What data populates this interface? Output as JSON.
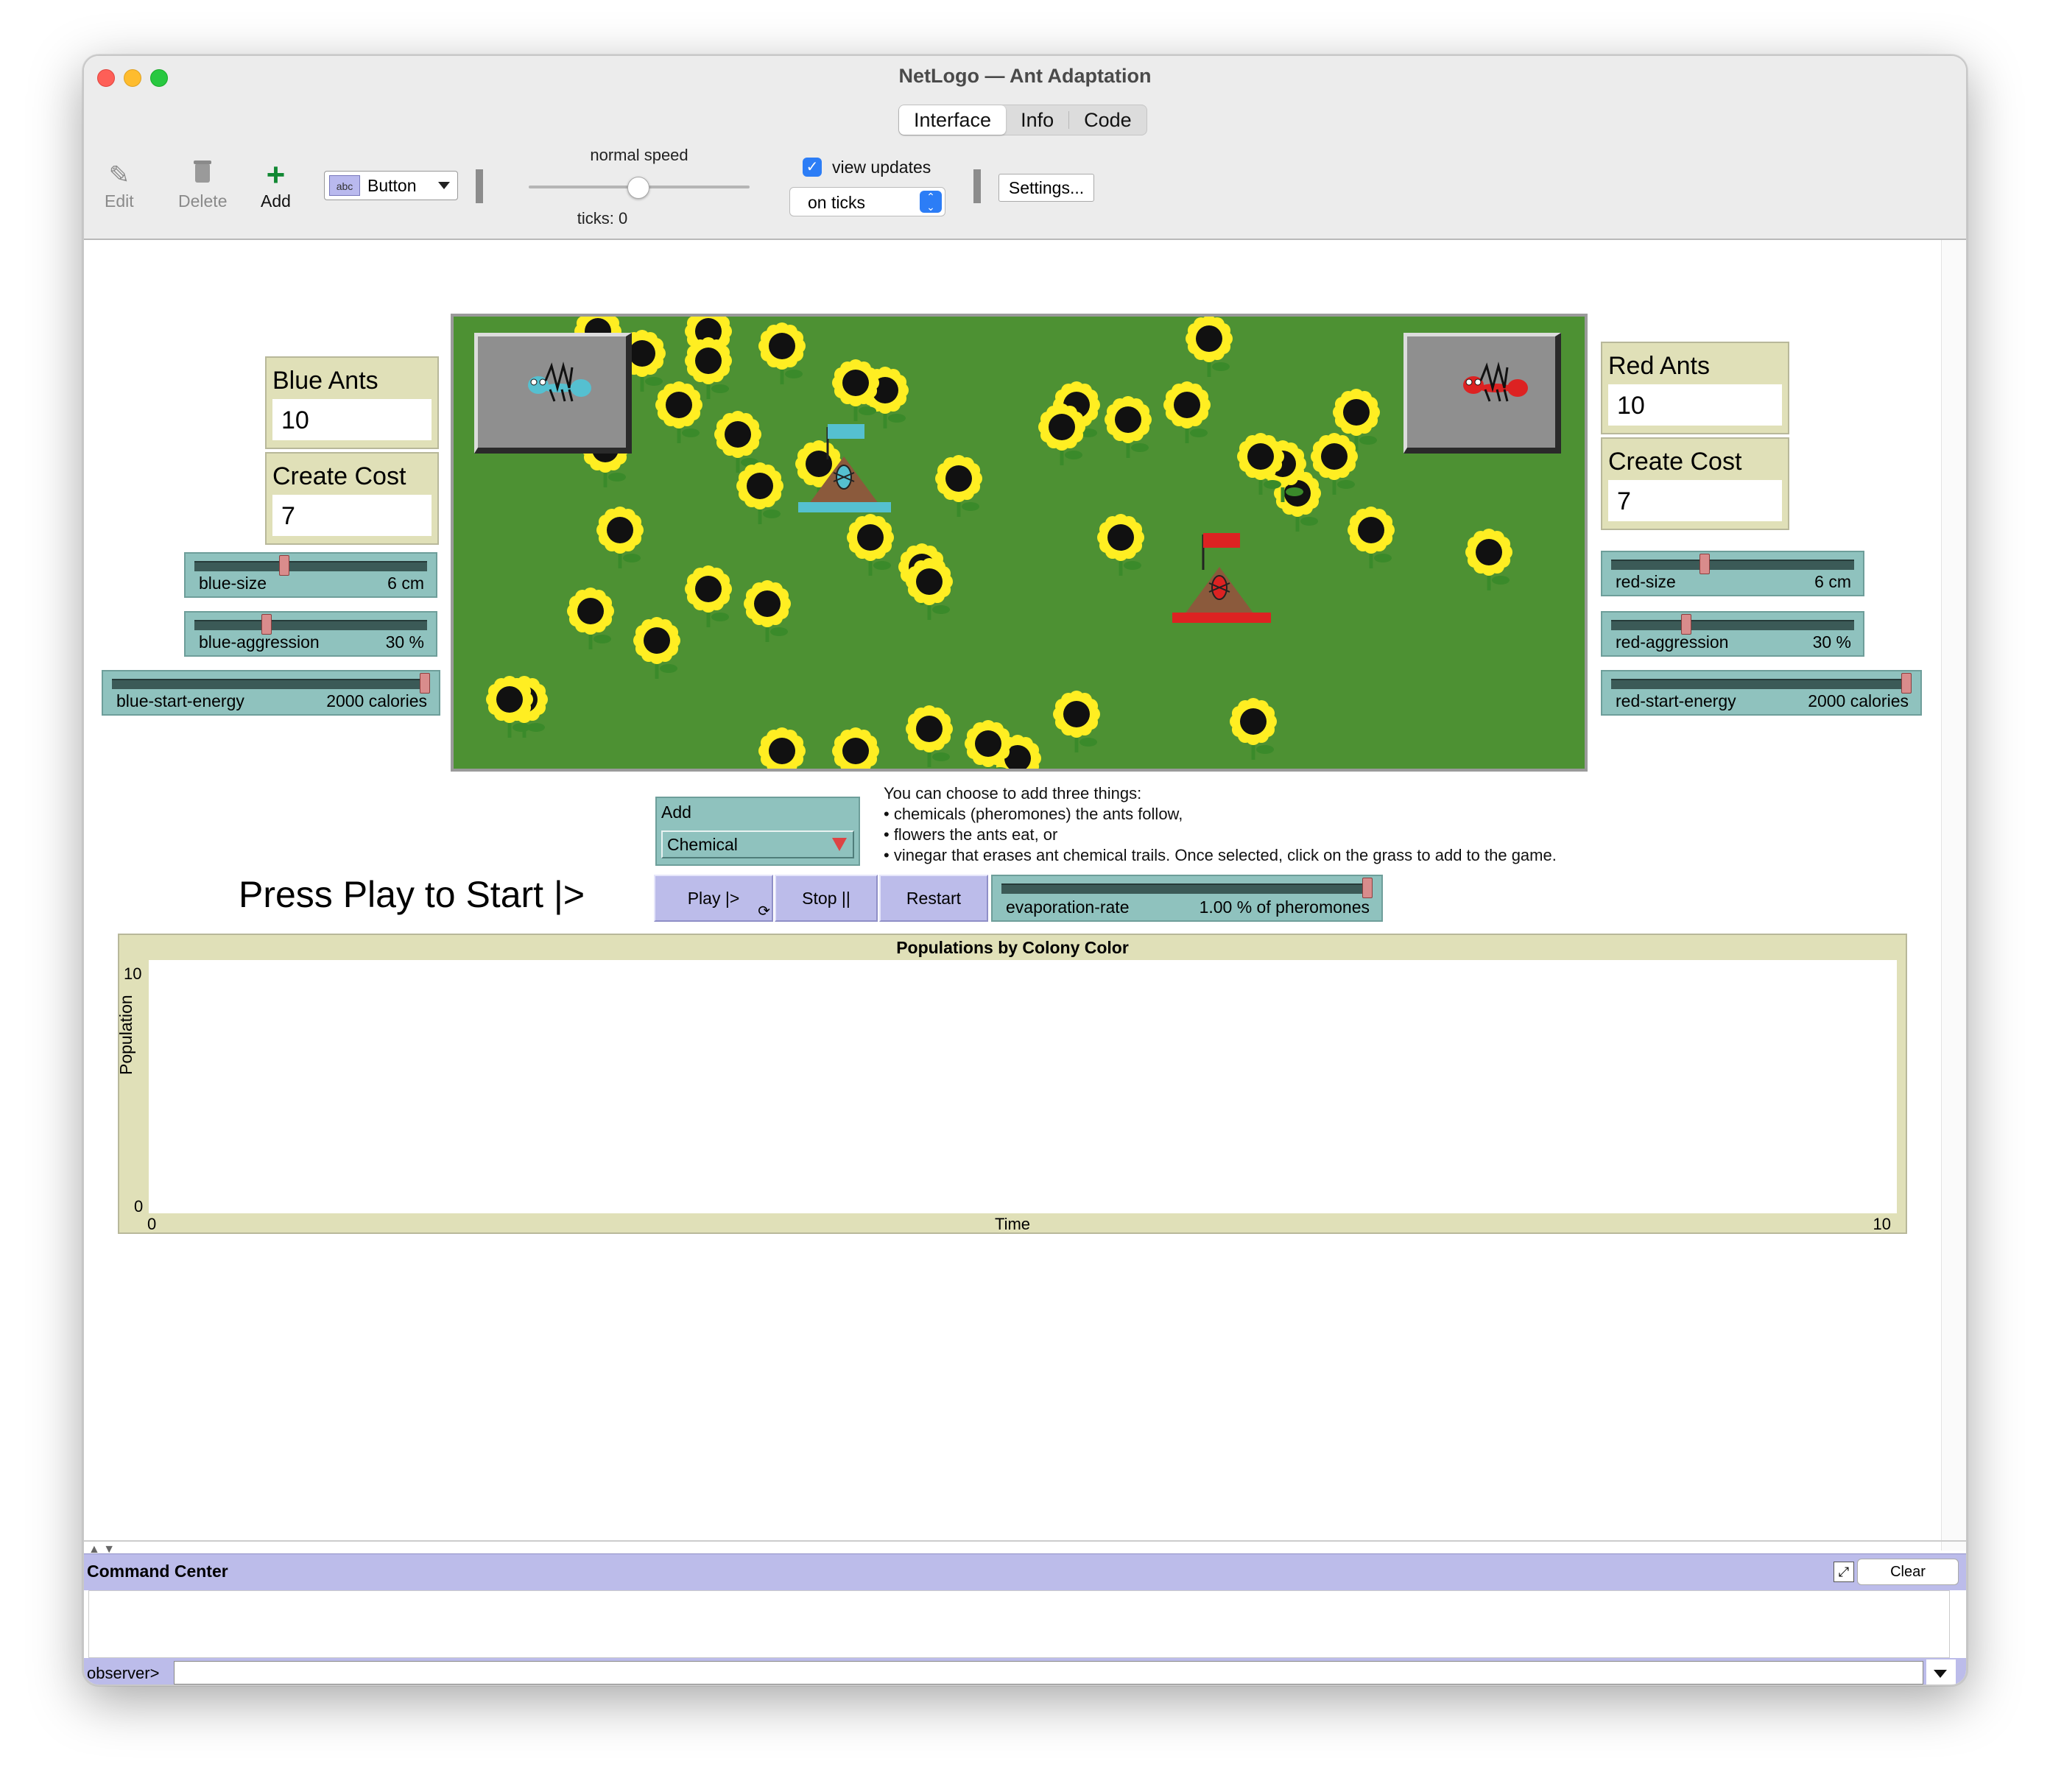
{
  "window": {
    "title": "NetLogo — Ant Adaptation"
  },
  "tabs": [
    {
      "label": "Interface",
      "active": true
    },
    {
      "label": "Info",
      "active": false
    },
    {
      "label": "Code",
      "active": false
    }
  ],
  "toolbar": {
    "edit_label": "Edit",
    "delete_label": "Delete",
    "add_label": "Add",
    "widget_type": "Button",
    "speed_label": "normal speed",
    "speed_value": 0.5,
    "ticks_label": "ticks: 0",
    "view_updates_label": "view updates",
    "view_updates_checked": true,
    "update_mode": "on ticks",
    "settings_label": "Settings..."
  },
  "icons": {
    "edit": "pencil-icon",
    "delete": "trash-icon",
    "add": "plus-icon",
    "widget_type": "button-widget-icon"
  },
  "monitors": {
    "blue_ants": {
      "label": "Blue Ants",
      "value": "10"
    },
    "blue_cost": {
      "label": "Create Cost",
      "value": "7"
    },
    "red_ants": {
      "label": "Red Ants",
      "value": "10"
    },
    "red_cost": {
      "label": "Create Cost",
      "value": "7"
    }
  },
  "sliders": {
    "blue_size": {
      "name": "blue-size",
      "value": "6 cm",
      "fraction": 0.38
    },
    "blue_aggression": {
      "name": "blue-aggression",
      "value": "30 %",
      "fraction": 0.3
    },
    "blue_start_energy": {
      "name": "blue-start-energy",
      "value": "2000 calories",
      "fraction": 1.0
    },
    "red_size": {
      "name": "red-size",
      "value": "6 cm",
      "fraction": 0.38
    },
    "red_aggression": {
      "name": "red-aggression",
      "value": "30 %",
      "fraction": 0.3
    },
    "red_start_energy": {
      "name": "red-start-energy",
      "value": "2000 calories",
      "fraction": 1.0
    },
    "evaporation_rate": {
      "name": "evaporation-rate",
      "value": "1.00 % of pheromones",
      "fraction": 1.0
    }
  },
  "chooser": {
    "label": "Add",
    "value": "Chemical"
  },
  "instructions": [
    "You can choose to add three things:",
    "• chemicals (pheromones) the ants follow,",
    "• flowers the ants eat, or",
    "• vinegar that erases ant chemical trails. Once selected, click on the grass to add to the game."
  ],
  "start_note": "Press Play to Start |>",
  "buttons": {
    "play": "Play |>",
    "stop": "Stop ||",
    "restart": "Restart"
  },
  "plot": {
    "title": "Populations by Colony Color",
    "ylabel": "Population",
    "xlabel": "Time",
    "y_max": "10",
    "y_min": "0",
    "x_min": "0",
    "x_max": "10"
  },
  "command_center": {
    "title": "Command Center",
    "clear_label": "Clear",
    "prompt": "observer>"
  },
  "colors": {
    "grass": "#4d9133",
    "petal": "#ffee22",
    "blue_colony": "#55c0d0",
    "red_colony": "#dd2222",
    "button_bg": "#bcbcea",
    "slider_bg": "#8fc2be",
    "monitor_bg": "#e0e0b8"
  }
}
